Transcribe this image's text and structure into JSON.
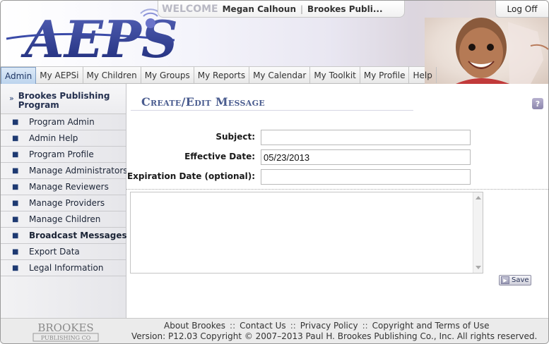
{
  "header": {
    "logo_text": "AEPSi",
    "welcome_label": "WELCOME",
    "user_name": "Megan Calhoun",
    "separator": "|",
    "org_name": "Brookes Publi...",
    "logoff_label": "Log Off"
  },
  "nav": {
    "tabs": [
      {
        "label": "Admin",
        "active": true
      },
      {
        "label": "My AEPSi"
      },
      {
        "label": "My Children"
      },
      {
        "label": "My Groups"
      },
      {
        "label": "My Reports"
      },
      {
        "label": "My Calendar"
      },
      {
        "label": "My Toolkit"
      },
      {
        "label": "My Profile"
      },
      {
        "label": "Help"
      }
    ]
  },
  "sidebar": {
    "group_label": "Brookes Publishing Program",
    "items": [
      {
        "label": "Program Admin"
      },
      {
        "label": "Admin Help"
      },
      {
        "label": "Program Profile"
      },
      {
        "label": "Manage Administrators"
      },
      {
        "label": "Manage Reviewers"
      },
      {
        "label": "Manage Providers"
      },
      {
        "label": "Manage Children"
      },
      {
        "label": "Broadcast Messages",
        "active": true
      },
      {
        "label": "Export Data"
      },
      {
        "label": "Legal Information"
      }
    ]
  },
  "main": {
    "title": "Create/Edit Message",
    "help_label": "?",
    "subject_label": "Subject:",
    "subject_value": "",
    "effective_date_label": "Effective Date:",
    "effective_date_value": "05/23/2013",
    "expiration_date_label": "Expiration Date (optional):",
    "expiration_date_value": "",
    "message_value": "",
    "save_label": "Save"
  },
  "footer": {
    "brookes_logo_line1": "BROOKES",
    "brookes_logo_line2": "PUBLISHING CO",
    "links": [
      "About Brookes",
      "Contact Us",
      "Privacy Policy",
      "Copyright and Terms of Use"
    ],
    "link_separator": "::",
    "version_text": "Version: P12.03 Copyright © 2007–2013 Paul H. Brookes Publishing Co., Inc. All rights reserved."
  },
  "colors": {
    "logo_blue": "#2e3f8f",
    "nav_active": "#bcd4ee",
    "sidebar_bg": "#e6e6ea",
    "title_color": "#4a5c8f"
  }
}
